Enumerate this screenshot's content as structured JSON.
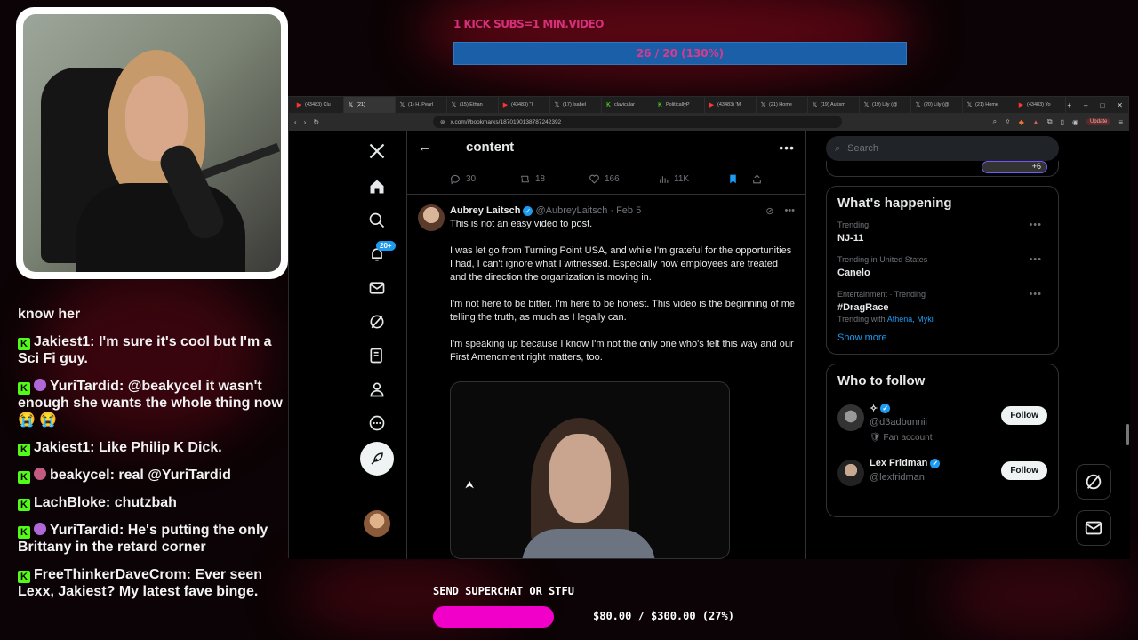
{
  "overlay": {
    "subs_title": "1 KICK SUBS=1 MIN.VIDEO",
    "subs_progress_text": "26 / 20 (130%)",
    "subs_progress_fraction": 1.3,
    "superchat_title": "SEND SUPERCHAT OR STFU",
    "superchat_text": "$80.00 / $300.00 (27%)",
    "superchat_fraction": 0.27,
    "accent_magenta": "#f000c8",
    "bar_blue": "#1b5fa8"
  },
  "chat": [
    {
      "badge": "",
      "user": "",
      "text": "know her"
    },
    {
      "badge": "kick",
      "user": "Jakiest1",
      "text": "I'm sure it's cool but I'm a Sci Fi guy."
    },
    {
      "badge": "kick+sub",
      "user": "YuriTardid",
      "text": "@beakycel it wasn't enough she wants the whole thing now 😭 😭"
    },
    {
      "badge": "kick",
      "user": "Jakiest1",
      "text": "Like Philip K Dick."
    },
    {
      "badge": "kick+sub2",
      "user": "beakycel",
      "text": "real @YuriTardid"
    },
    {
      "badge": "kick",
      "user": "LachBloke",
      "text": "chutzbah"
    },
    {
      "badge": "kick+sub",
      "user": "YuriTardid",
      "text": "He's putting the only Brittany in the retard corner"
    },
    {
      "badge": "kick",
      "user": "FreeThinkerDaveCrom",
      "text": "Ever seen Lexx, Jakiest? My latest fave binge."
    }
  ],
  "browser": {
    "tabs": [
      {
        "icon": "youtube-icon",
        "label": "(43483) Clu"
      },
      {
        "icon": "x-icon",
        "label": "(21)",
        "active": true
      },
      {
        "icon": "x-icon",
        "label": "(1) H. Pearl"
      },
      {
        "icon": "x-icon",
        "label": "(15) Ethan"
      },
      {
        "icon": "youtube-icon",
        "label": "(43483) \"I"
      },
      {
        "icon": "x-icon",
        "label": "(17) Isabel"
      },
      {
        "icon": "kick-icon",
        "label": "clavicular"
      },
      {
        "icon": "kick-icon",
        "label": "PoliticallyP"
      },
      {
        "icon": "youtube-icon",
        "label": "(43483) 'M"
      },
      {
        "icon": "x-icon",
        "label": "(21) Home"
      },
      {
        "icon": "x-icon",
        "label": "(19) Autism"
      },
      {
        "icon": "x-icon",
        "label": "(19) Lily (@"
      },
      {
        "icon": "x-icon",
        "label": "(20) Lily (@"
      },
      {
        "icon": "x-icon",
        "label": "(21) Home"
      },
      {
        "icon": "youtube-icon",
        "label": "(43483) Yo"
      }
    ],
    "url": "x.com/i/bookmarks/1870190138787242392",
    "update_label": "Update"
  },
  "x": {
    "nav_badge": "20+",
    "feed_title": "content",
    "prev_actions": {
      "replies": "30",
      "reposts": "18",
      "likes": "166",
      "views": "11K"
    },
    "tweet": {
      "name": "Aubrey Laitsch",
      "handle": "@AubreyLaitsch",
      "date": "· Feb 5",
      "paragraphs": [
        "This is not an easy video to post.",
        "I was let go from Turning Point USA, and while I'm grateful for the opportunities I had, I can't ignore what I witnessed. Especially how employees are treated and the direction the organization is moving in.",
        "I'm not here to be bitter. I'm here to be honest. This video is the beginning of me telling the truth, as much as I legally can.",
        "I'm speaking up because I know I'm not the only one who's felt this way and our First Amendment right matters, too."
      ]
    },
    "search_placeholder": "Search",
    "peek_count": "+6",
    "happening": {
      "title": "What's happening",
      "trends": [
        {
          "meta": "Trending",
          "name": "NJ-11",
          "with": ""
        },
        {
          "meta": "Trending in United States",
          "name": "Canelo",
          "with": ""
        },
        {
          "meta": "Entertainment · Trending",
          "name": "#DragRace",
          "with_prefix": "Trending with",
          "with": "Athena, Myki"
        }
      ],
      "show_more": "Show more"
    },
    "who_to_follow": {
      "title": "Who to follow",
      "accounts": [
        {
          "name": "✧",
          "handle": "@d3adbunnii",
          "sub": "🛡 Fan account",
          "button": "Follow"
        },
        {
          "name": "Lex Fridman",
          "handle": "@lexfridman",
          "sub": "",
          "button": "Follow"
        }
      ]
    }
  }
}
